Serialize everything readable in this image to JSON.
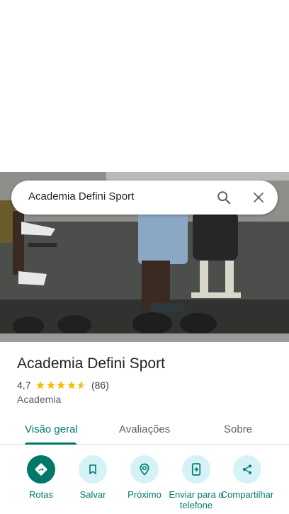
{
  "search": {
    "query": "Academia Defini Sport"
  },
  "place": {
    "name": "Academia Defini Sport",
    "rating": "4,7",
    "rating_value": 4.7,
    "reviews_count": "(86)",
    "category": "Academia"
  },
  "tabs": [
    {
      "label": "Visão geral",
      "active": true
    },
    {
      "label": "Avaliações",
      "active": false
    },
    {
      "label": "Sobre",
      "active": false
    }
  ],
  "actions": [
    {
      "label": "Rotas",
      "icon": "directions-icon"
    },
    {
      "label": "Salvar",
      "icon": "bookmark-icon"
    },
    {
      "label": "Próximo",
      "icon": "nearby-icon"
    },
    {
      "label": "Enviar para o telefone",
      "icon": "send-to-phone-icon"
    },
    {
      "label": "Compartilhar",
      "icon": "share-icon"
    }
  ],
  "colors": {
    "accent": "#00796b",
    "action_bg": "#d5f3f7",
    "star": "#fbbc04"
  }
}
